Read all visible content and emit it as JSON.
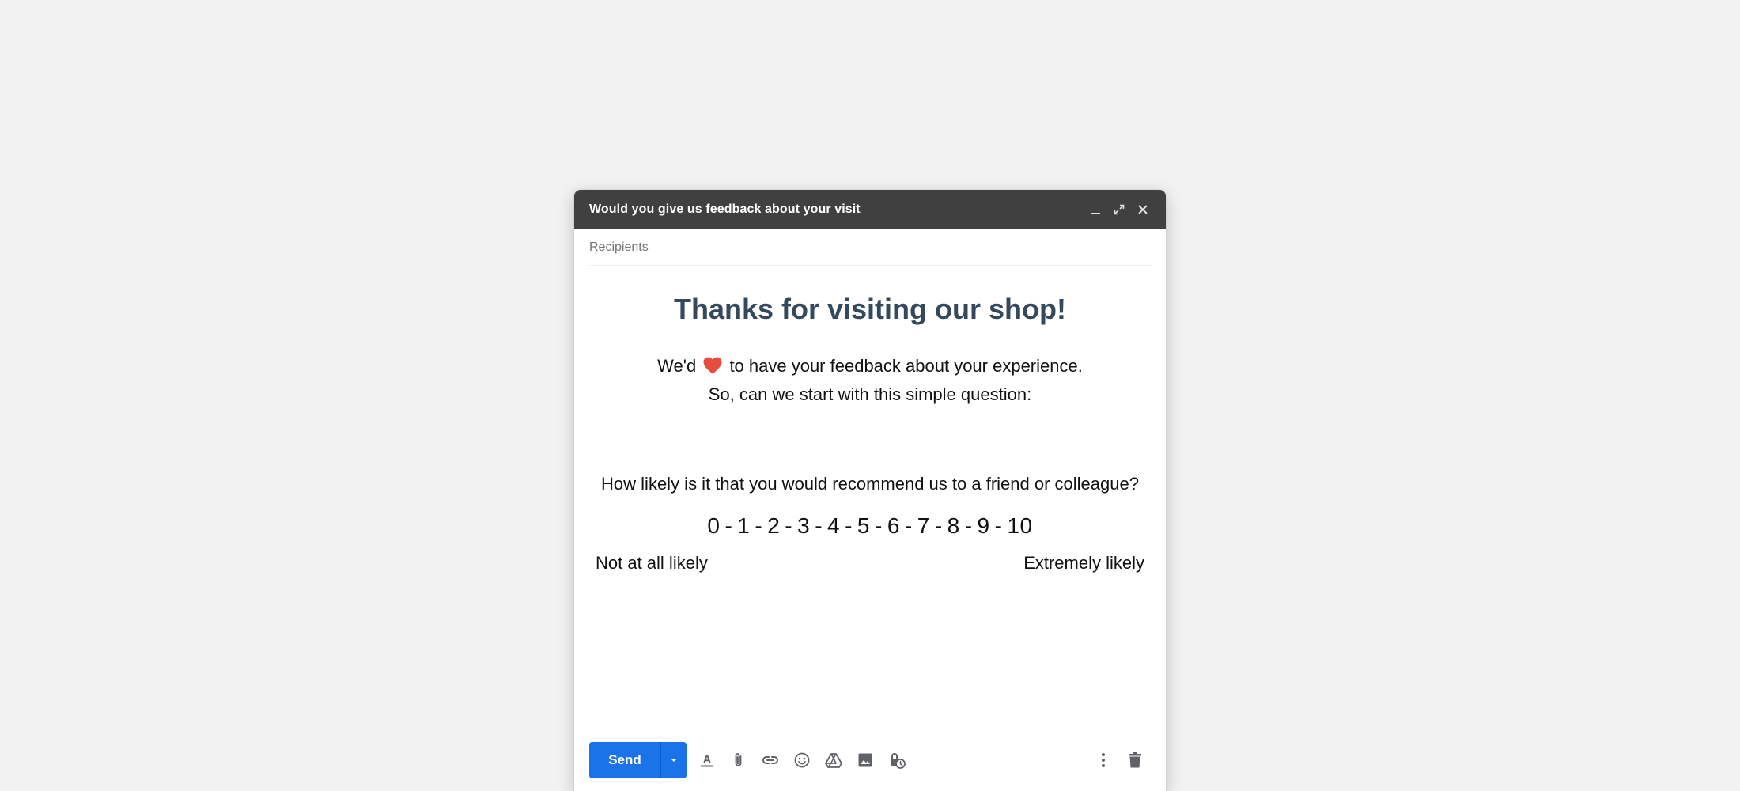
{
  "window": {
    "title": "Would you give us feedback about your visit"
  },
  "recipients": {
    "label": "Recipients"
  },
  "email": {
    "headline": "Thanks for visiting our shop!",
    "intro_before_heart": "We'd",
    "intro_after_heart": "to have your feedback about your experience.",
    "intro_line2": "So, can we start with this simple question:",
    "question": "How likely is it that you would recommend us to a friend or colleague?",
    "scale": [
      "0",
      "1",
      "2",
      "3",
      "4",
      "5",
      "6",
      "7",
      "8",
      "9",
      "10"
    ],
    "scale_separator": "-",
    "label_low": "Not at all likely",
    "label_high": "Extremely likely"
  },
  "toolbar": {
    "send_label": "Send"
  },
  "colors": {
    "titlebar": "#404040",
    "headline": "#34495e",
    "send_button": "#1a73e8",
    "heart": "#e74c3c",
    "icon": "#5f6368"
  },
  "icons": {
    "titlebar": [
      "minimize-icon",
      "fullscreen-icon",
      "close-icon"
    ],
    "toolbar": [
      "send-options-icon",
      "text-format-icon",
      "attach-icon",
      "link-icon",
      "emoji-icon",
      "drive-icon",
      "photo-icon",
      "confidential-icon",
      "more-options-icon",
      "delete-icon"
    ]
  }
}
